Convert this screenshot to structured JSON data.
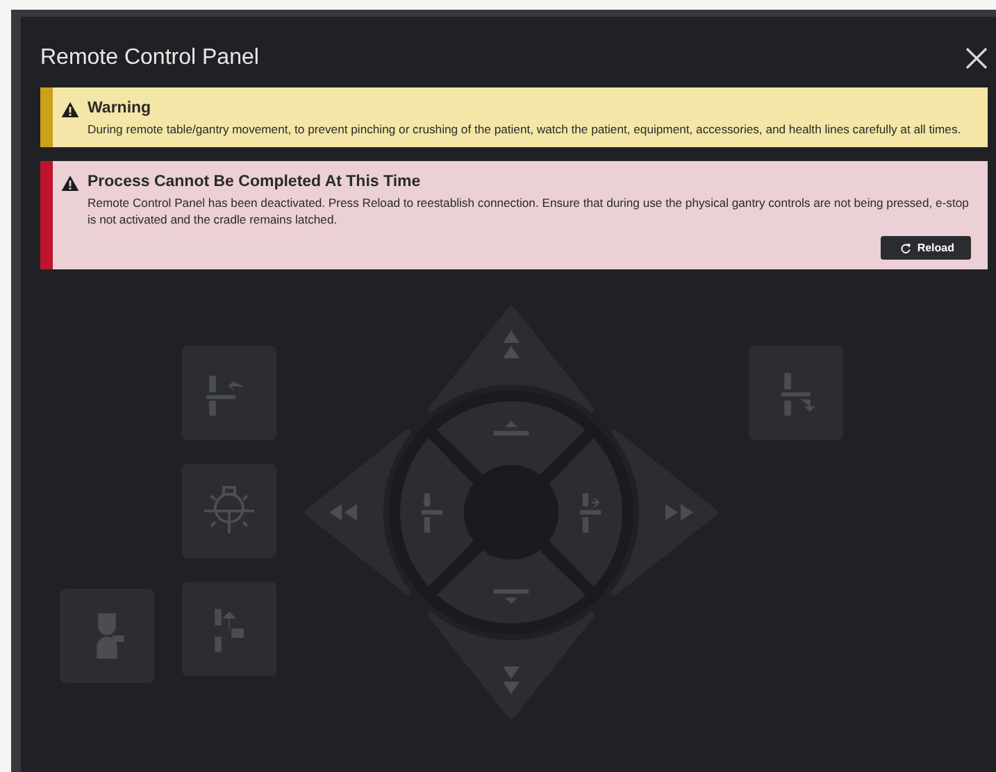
{
  "window": {
    "title": "Remote Control Panel"
  },
  "alerts": [
    {
      "kind": "warning",
      "title": "Warning",
      "message": "During remote table/gantry movement, to prevent pinching or crushing of the patient, watch the patient, equipment, accessories, and health lines carefully at all times."
    },
    {
      "kind": "error",
      "title": "Process Cannot Be Completed At This Time",
      "message": "Remote Control Panel has been deactivated. Press Reload to reestablish connection. Ensure that during use the physical gantry controls are not being pressed, e-stop is not activated and the cradle remains latched.",
      "action": "Reload"
    }
  ],
  "pad": {
    "disabled": true
  }
}
